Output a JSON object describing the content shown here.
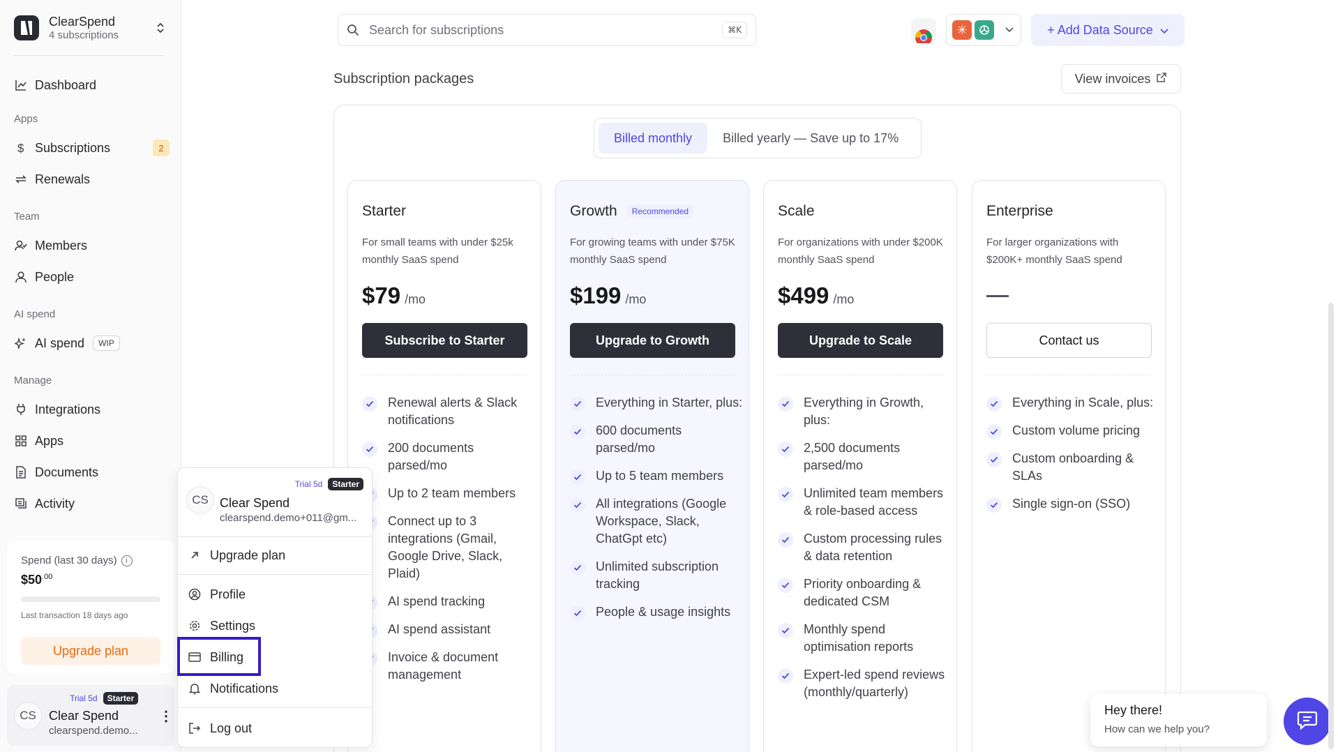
{
  "workspace": {
    "name": "ClearSpend",
    "subscriptions_count": "4 subscriptions"
  },
  "nav": {
    "dashboard": "Dashboard",
    "apps_section": "Apps",
    "subscriptions": "Subscriptions",
    "subscriptions_badge": "2",
    "renewals": "Renewals",
    "team_section": "Team",
    "members": "Members",
    "people": "People",
    "ai_section": "AI spend",
    "ai_spend": "AI spend",
    "ai_spend_badge": "WIP",
    "manage_section": "Manage",
    "integrations": "Integrations",
    "apps": "Apps",
    "documents": "Documents",
    "activity": "Activity"
  },
  "spend": {
    "label": "Spend (last 30 days)",
    "amount_main": "$50",
    "amount_cents": ".00",
    "last_transaction": "Last transaction 18 days ago",
    "upgrade_label": "Upgrade plan",
    "progress_fraction": 0
  },
  "user": {
    "initials": "CS",
    "trial": "Trial 5d",
    "plan": "Starter",
    "name": "Clear Spend",
    "email_short": "clearspend.demo...",
    "email_menu": "clearspend.demo+011@gm..."
  },
  "search": {
    "placeholder": "Search for subscriptions",
    "shortcut": "⌘K"
  },
  "topbar": {
    "add_source": "+ Add Data Source"
  },
  "main": {
    "title": "Subscription packages",
    "view_invoices": "View invoices",
    "billing_monthly": "Billed monthly",
    "billing_yearly": "Billed yearly — Save up to 17%"
  },
  "plans": [
    {
      "name": "Starter",
      "desc": "For small teams with under $25k monthly SaaS spend",
      "price": "$79",
      "per": "/mo",
      "cta": "Subscribe to Starter",
      "features": [
        "Renewal alerts & Slack notifications",
        "200 documents parsed/mo",
        "Up to 2 team members",
        "Connect up to 3 integrations (Gmail, Google Drive, Slack, Plaid)",
        "AI spend tracking",
        "AI spend assistant",
        "Invoice & document management"
      ]
    },
    {
      "name": "Growth",
      "badge": "Recommended",
      "desc": "For growing teams with under $75K monthly SaaS spend",
      "price": "$199",
      "per": "/mo",
      "cta": "Upgrade to Growth",
      "features": [
        "Everything in Starter, plus:",
        "600 documents parsed/mo",
        "Up to 5 team members",
        "All integrations (Google Workspace, Slack, ChatGpt etc)",
        "Unlimited subscription tracking",
        "People & usage insights"
      ]
    },
    {
      "name": "Scale",
      "desc": "For organizations with under $200K monthly SaaS spend",
      "price": "$499",
      "per": "/mo",
      "cta": "Upgrade to Scale",
      "features": [
        "Everything in Growth, plus:",
        "2,500 documents parsed/mo",
        "Unlimited team members & role-based access",
        "Custom processing rules & data retention",
        "Priority onboarding & dedicated CSM",
        "Monthly spend optimisation reports",
        "Expert-led spend reviews (monthly/quarterly)"
      ]
    },
    {
      "name": "Enterprise",
      "desc": "For larger organizations with $200K+ monthly SaaS spend",
      "price": "—",
      "cta": "Contact us",
      "features": [
        "Everything in Scale, plus:",
        "Custom volume pricing",
        "Custom onboarding & SLAs",
        "Single sign-on (SSO)"
      ]
    }
  ],
  "menu": {
    "upgrade_plan": "Upgrade plan",
    "profile": "Profile",
    "settings": "Settings",
    "billing": "Billing",
    "notifications": "Notifications",
    "logout": "Log out"
  },
  "chat": {
    "title": "Hey there!",
    "subtitle": "How can we help you?"
  },
  "colors": {
    "accent": "#4f46e5",
    "highlight": "#3a1ac7",
    "dark_button": "#2f2f3a",
    "orange": "#ea6c0c"
  },
  "icons": {
    "search": "search-icon",
    "chrome": "chrome-icon",
    "claude": "claude-icon",
    "openai": "openai-icon",
    "external_link": "external-link-icon",
    "check": "check-icon",
    "chat": "chat-icon"
  }
}
